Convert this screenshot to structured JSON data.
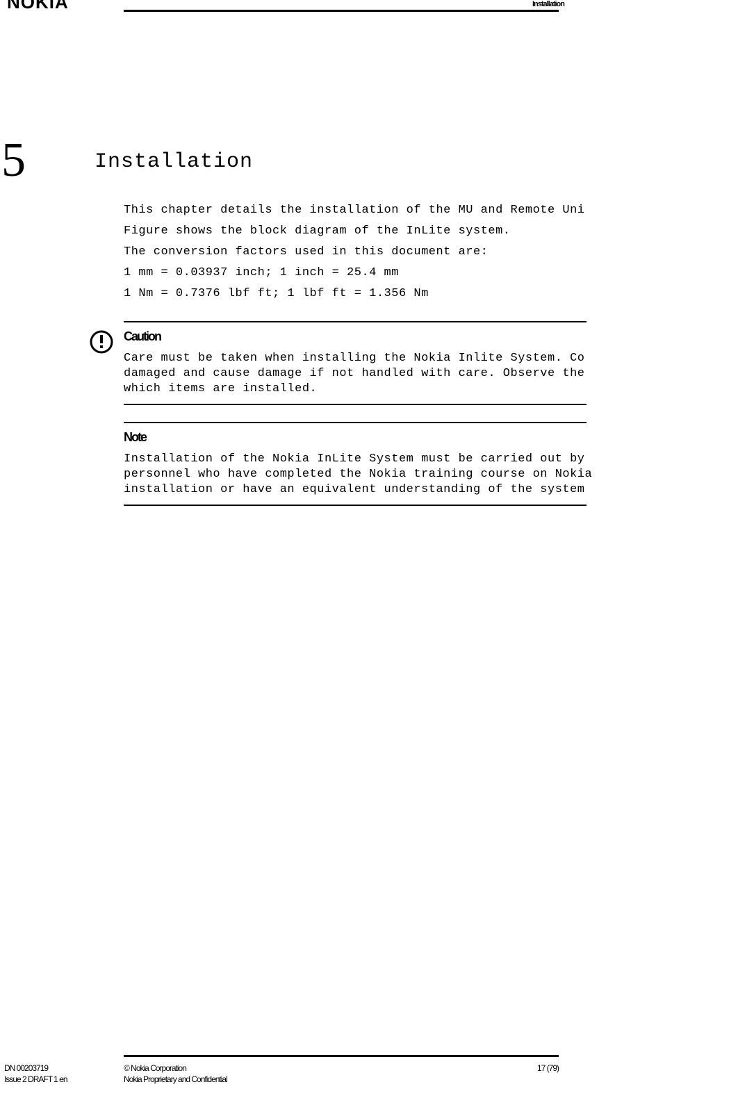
{
  "header": {
    "logo": "NOKIA",
    "label": "Installation"
  },
  "chapter": {
    "number": "5",
    "title": "Installation"
  },
  "body": {
    "p1": "This chapter details the installation of the MU and Remote Uni",
    "p2": "Figure  shows the block diagram of the InLite system.",
    "p3": "The conversion factors used in this document are:",
    "p4": "1 mm = 0.03937 inch; 1 inch = 25.4 mm",
    "p5": "1 Nm = 0.7376 lbf ft; 1 lbf ft = 1.356 Nm"
  },
  "caution": {
    "head": "Caution",
    "l1": "Care must be taken when installing the Nokia Inlite System. Co",
    "l2": "damaged and cause damage if not handled with care. Observe the",
    "l3": "which items are installed."
  },
  "note": {
    "head": "Note",
    "l1": "Installation of the Nokia InLite System must be carried out by",
    "l2": "personnel who have completed the Nokia training course on Nokia",
    "l3": "installation or have an equivalent understanding of the system"
  },
  "footer": {
    "dn": "DN 00203719",
    "issue": "Issue 2 DRAFT 1 en",
    "copy": "© Nokia Corporation",
    "conf": "Nokia Proprietary and Confidential",
    "page": "17 (79)"
  }
}
